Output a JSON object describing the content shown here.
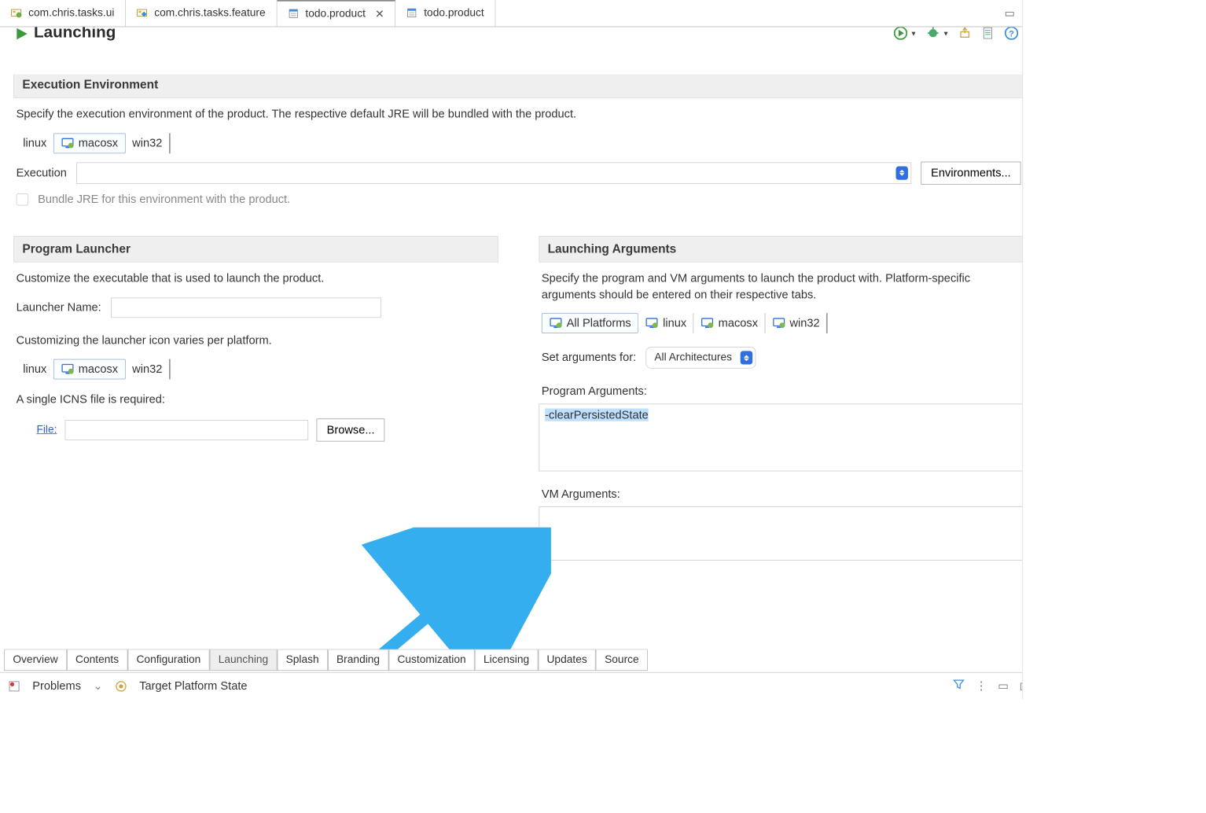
{
  "editorTabs": {
    "tab1": "com.chris.tasks.ui",
    "tab2": "com.chris.tasks.feature",
    "tab3": "todo.product",
    "tab4": "todo.product"
  },
  "page": {
    "title": "Launching"
  },
  "execEnv": {
    "header": "Execution Environment",
    "desc": "Specify the execution environment of the product. The respective default JRE will be bundled with the product.",
    "os": {
      "linux": "linux",
      "macosx": "macosx",
      "win32": "win32"
    },
    "executionLabel": "Execution",
    "environmentsBtn": "Environments...",
    "bundleJre": "Bundle JRE for this environment with the product."
  },
  "launcher": {
    "header": "Program Launcher",
    "desc": "Customize the executable that is used to launch the product.",
    "nameLabel": "Launcher Name:",
    "iconNote": "Customizing the launcher icon varies per platform.",
    "os": {
      "linux": "linux",
      "macosx": "macosx",
      "win32": "win32"
    },
    "icnsNote": "A single ICNS file is required:",
    "fileLabel": "File:",
    "browseBtn": "Browse..."
  },
  "args": {
    "header": "Launching Arguments",
    "desc": "Specify the program and VM arguments to launch the product with.  Platform-specific arguments should be entered on their respective tabs.",
    "platforms": {
      "all": "All Platforms",
      "linux": "linux",
      "macosx": "macosx",
      "win32": "win32"
    },
    "setArgsLabel": "Set arguments for:",
    "archSelect": "All Architectures",
    "programArgsLabel": "Program Arguments:",
    "programArgsValue": "-clearPersistedState",
    "vmArgsLabel": "VM Arguments:"
  },
  "bottomTabs": {
    "overview": "Overview",
    "contents": "Contents",
    "configuration": "Configuration",
    "launching": "Launching",
    "splash": "Splash",
    "branding": "Branding",
    "customization": "Customization",
    "licensing": "Licensing",
    "updates": "Updates",
    "source": "Source"
  },
  "views": {
    "problems": "Problems",
    "targetPlatform": "Target Platform State"
  }
}
